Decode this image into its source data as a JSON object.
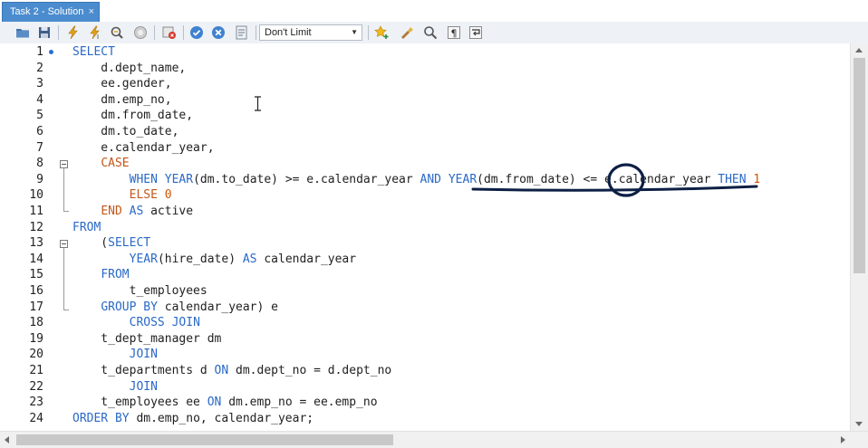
{
  "tab": {
    "title": "Task 2 - Solution",
    "close": "×"
  },
  "toolbar": {
    "icons": [
      "open-folder-icon",
      "save-icon",
      "execute-icon",
      "execute-current-icon",
      "explain-icon",
      "stop-icon",
      "toggle-error-icon",
      "commit-icon",
      "rollback-icon",
      "autocommit-icon",
      "bookmark-icon",
      "beautify-icon",
      "find-icon",
      "invisible-chars-icon",
      "wrap-icon"
    ],
    "limit_value": "Don't Limit"
  },
  "editor": {
    "line_numbers": [
      "1",
      "2",
      "3",
      "4",
      "5",
      "6",
      "7",
      "8",
      "9",
      "10",
      "11",
      "12",
      "13",
      "14",
      "15",
      "16",
      "17",
      "18",
      "19",
      "20",
      "21",
      "22",
      "23",
      "24"
    ],
    "lines": [
      [
        {
          "t": "SELECT",
          "c": "kw"
        }
      ],
      [
        {
          "t": "    d.dept_name,",
          "c": ""
        }
      ],
      [
        {
          "t": "    ee.gender,",
          "c": ""
        }
      ],
      [
        {
          "t": "    dm.emp_no,",
          "c": ""
        }
      ],
      [
        {
          "t": "    dm.from_date,",
          "c": ""
        }
      ],
      [
        {
          "t": "    dm.to_date,",
          "c": ""
        }
      ],
      [
        {
          "t": "    e.calendar_year,",
          "c": ""
        }
      ],
      [
        {
          "t": "    ",
          "c": ""
        },
        {
          "t": "CASE",
          "c": "kwo"
        }
      ],
      [
        {
          "t": "        ",
          "c": ""
        },
        {
          "t": "WHEN",
          "c": "kw"
        },
        {
          "t": " ",
          "c": ""
        },
        {
          "t": "YEAR",
          "c": "kw"
        },
        {
          "t": "(dm.to_date) >= e.calendar_year ",
          "c": ""
        },
        {
          "t": "AND",
          "c": "kw"
        },
        {
          "t": " ",
          "c": ""
        },
        {
          "t": "YEAR",
          "c": "kw"
        },
        {
          "t": "(dm.from_date) <= e.calendar_year ",
          "c": ""
        },
        {
          "t": "THEN",
          "c": "kw"
        },
        {
          "t": " ",
          "c": ""
        },
        {
          "t": "1",
          "c": "num"
        }
      ],
      [
        {
          "t": "        ",
          "c": ""
        },
        {
          "t": "ELSE",
          "c": "kwo"
        },
        {
          "t": " ",
          "c": ""
        },
        {
          "t": "0",
          "c": "num"
        }
      ],
      [
        {
          "t": "    ",
          "c": ""
        },
        {
          "t": "END",
          "c": "kwo"
        },
        {
          "t": " ",
          "c": ""
        },
        {
          "t": "AS",
          "c": "kw"
        },
        {
          "t": " active",
          "c": ""
        }
      ],
      [
        {
          "t": "FROM",
          "c": "kw"
        }
      ],
      [
        {
          "t": "    (",
          "c": ""
        },
        {
          "t": "SELECT",
          "c": "kw"
        }
      ],
      [
        {
          "t": "        ",
          "c": ""
        },
        {
          "t": "YEAR",
          "c": "kw"
        },
        {
          "t": "(hire_date) ",
          "c": ""
        },
        {
          "t": "AS",
          "c": "kw"
        },
        {
          "t": " calendar_year",
          "c": ""
        }
      ],
      [
        {
          "t": "    ",
          "c": ""
        },
        {
          "t": "FROM",
          "c": "kw"
        }
      ],
      [
        {
          "t": "        t_employees",
          "c": ""
        }
      ],
      [
        {
          "t": "    ",
          "c": ""
        },
        {
          "t": "GROUP BY",
          "c": "kw"
        },
        {
          "t": " calendar_year) e",
          "c": ""
        }
      ],
      [
        {
          "t": "        ",
          "c": ""
        },
        {
          "t": "CROSS JOIN",
          "c": "kw"
        }
      ],
      [
        {
          "t": "    t_dept_manager dm",
          "c": ""
        }
      ],
      [
        {
          "t": "        ",
          "c": ""
        },
        {
          "t": "JOIN",
          "c": "kw"
        }
      ],
      [
        {
          "t": "    t_departments d ",
          "c": ""
        },
        {
          "t": "ON",
          "c": "kw"
        },
        {
          "t": " dm.dept_no = d.dept_no",
          "c": ""
        }
      ],
      [
        {
          "t": "        ",
          "c": ""
        },
        {
          "t": "JOIN",
          "c": "kw"
        }
      ],
      [
        {
          "t": "    t_employees ee ",
          "c": ""
        },
        {
          "t": "ON",
          "c": "kw"
        },
        {
          "t": " dm.emp_no = ee.emp_no",
          "c": ""
        }
      ],
      [
        {
          "t": "ORDER BY",
          "c": "kw"
        },
        {
          "t": " dm.emp_no, calendar_year;",
          "c": ""
        }
      ]
    ]
  },
  "colors": {
    "keyword": "#2a69c7",
    "keyword_alt": "#c2571a",
    "number": "#d35400",
    "annotation": "#0d1f44",
    "tab": "#4b8ccf"
  }
}
